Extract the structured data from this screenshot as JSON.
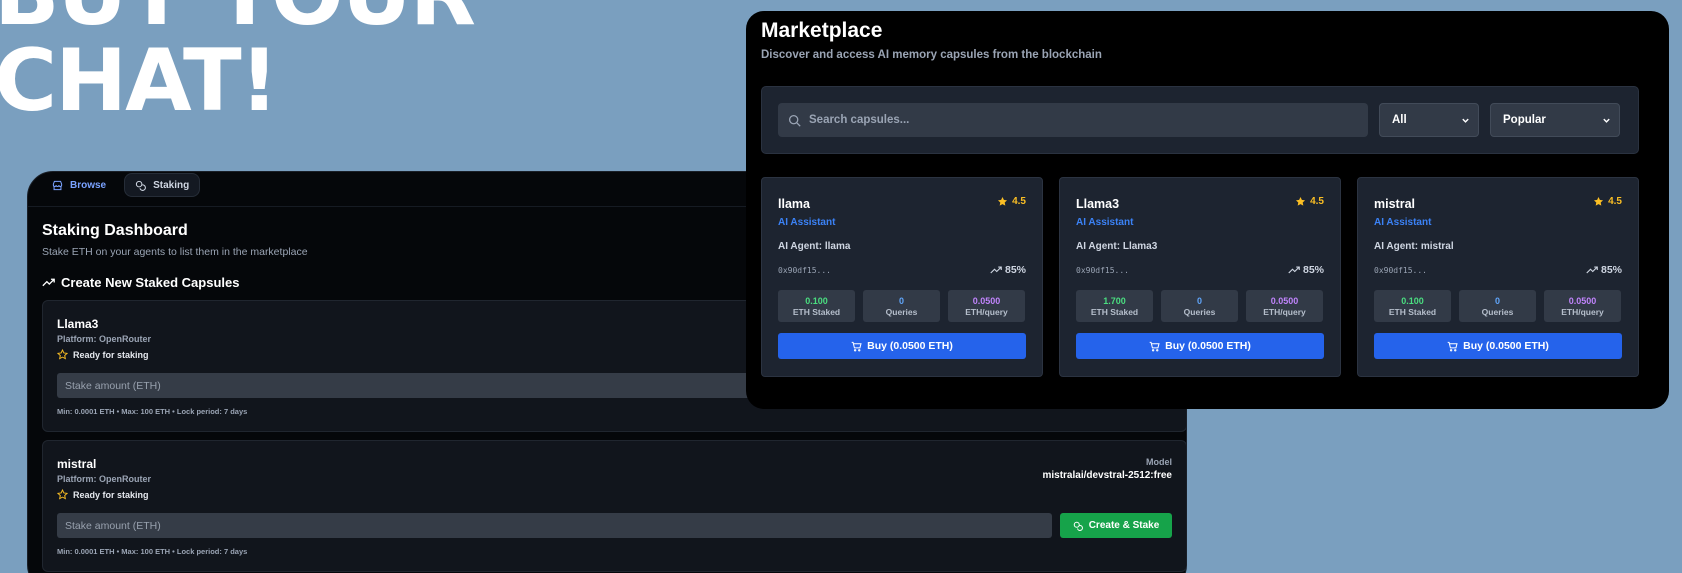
{
  "hero": {
    "line1": "BUY YOUR",
    "line2": "CHAT!"
  },
  "staking": {
    "tabs": [
      {
        "label": "Browse",
        "icon": "store-icon"
      },
      {
        "label": "Staking",
        "icon": "coins-icon"
      }
    ],
    "title": "Staking Dashboard",
    "subtitle": "Stake ETH on your agents to list them in the marketplace",
    "section_title": "Create New Staked Capsules",
    "capsules": [
      {
        "name": "Llama3",
        "platform": "Platform: OpenRouter",
        "status": "Ready for staking",
        "stake_placeholder": "Stake amount (ETH)",
        "limits": "Min: 0.0001 ETH • Max: 100 ETH • Lock period: 7 days"
      },
      {
        "name": "mistral",
        "platform": "Platform: OpenRouter",
        "status": "Ready for staking",
        "model_label": "Model",
        "model_value": "mistralai/devstral-2512:free",
        "stake_placeholder": "Stake amount (ETH)",
        "button": "Create & Stake",
        "limits": "Min: 0.0001 ETH • Max: 100 ETH • Lock period: 7 days"
      }
    ]
  },
  "marketplace": {
    "title": "Marketplace",
    "subtitle": "Discover and access AI memory capsules from the blockchain",
    "search_placeholder": "Search capsules...",
    "category_filter": "All",
    "sort_filter": "Popular",
    "cards": [
      {
        "name": "llama",
        "rating": "4.5",
        "category": "AI Assistant",
        "agent": "AI Agent: llama",
        "hash": "0x90df15...",
        "trend": "85%",
        "eth_staked": "0.100",
        "eth_staked_label": "ETH Staked",
        "queries": "0",
        "queries_label": "Queries",
        "price": "0.0500",
        "price_label": "ETH/query",
        "buy_label": "Buy (0.0500 ETH)"
      },
      {
        "name": "Llama3",
        "rating": "4.5",
        "category": "AI Assistant",
        "agent": "AI Agent: Llama3",
        "hash": "0x90df15...",
        "trend": "85%",
        "eth_staked": "1.700",
        "eth_staked_label": "ETH Staked",
        "queries": "0",
        "queries_label": "Queries",
        "price": "0.0500",
        "price_label": "ETH/query",
        "buy_label": "Buy (0.0500 ETH)"
      },
      {
        "name": "mistral",
        "rating": "4.5",
        "category": "AI Assistant",
        "agent": "AI Agent: mistral",
        "hash": "0x90df15...",
        "trend": "85%",
        "eth_staked": "0.100",
        "eth_staked_label": "ETH Staked",
        "queries": "0",
        "queries_label": "Queries",
        "price": "0.0500",
        "price_label": "ETH/query",
        "buy_label": "Buy (0.0500 ETH)"
      }
    ]
  },
  "colors": {
    "background": "#7a9fbf",
    "accent_blue": "#2563eb",
    "accent_green": "#16a34a",
    "star": "#fbbf24"
  }
}
